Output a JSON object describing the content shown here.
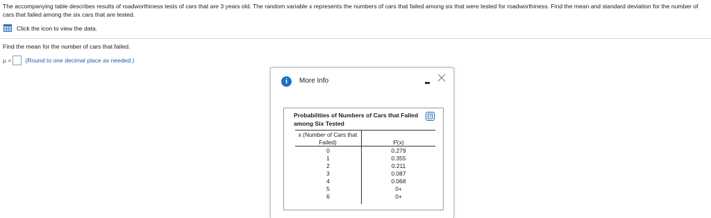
{
  "question": {
    "text": "The accompanying table describes results of roadworthiness tests of cars that are 3 years old. The random variable x represents the numbers of cars that failed among six that were tested for roadworthiness. Find the mean and standard deviation for the number of cars that failed among the six cars that are tested.",
    "view_data_label": "Click the icon to view the data.",
    "view_data_icon": "table-icon"
  },
  "prompt": {
    "instruction": "Find the mean for the number of cars that failed.",
    "mu_label": "μ =",
    "answer_value": "",
    "hint": "(Round to one decimal place as needed.)"
  },
  "dialog": {
    "title": "More Info",
    "info_icon": "info-icon",
    "minimize_icon": "minimize-icon",
    "close_icon": "close-icon",
    "table": {
      "title": "Probabilities of Numbers of Cars that Failed among Six Tested",
      "copy_icon": "copy-icon",
      "header_x": "x (Number of Cars that Failed)",
      "header_p": "P(x)",
      "rows": [
        {
          "x": "0",
          "p": "0.279"
        },
        {
          "x": "1",
          "p": "0.355"
        },
        {
          "x": "2",
          "p": "0.211"
        },
        {
          "x": "3",
          "p": "0.087"
        },
        {
          "x": "4",
          "p": "0.068"
        },
        {
          "x": "5",
          "p": "0+"
        },
        {
          "x": "6",
          "p": "0+"
        }
      ]
    }
  },
  "colors": {
    "link_blue": "#1f5fa8",
    "info_blue": "#1f6fc9",
    "input_border": "#7f9fc8"
  }
}
